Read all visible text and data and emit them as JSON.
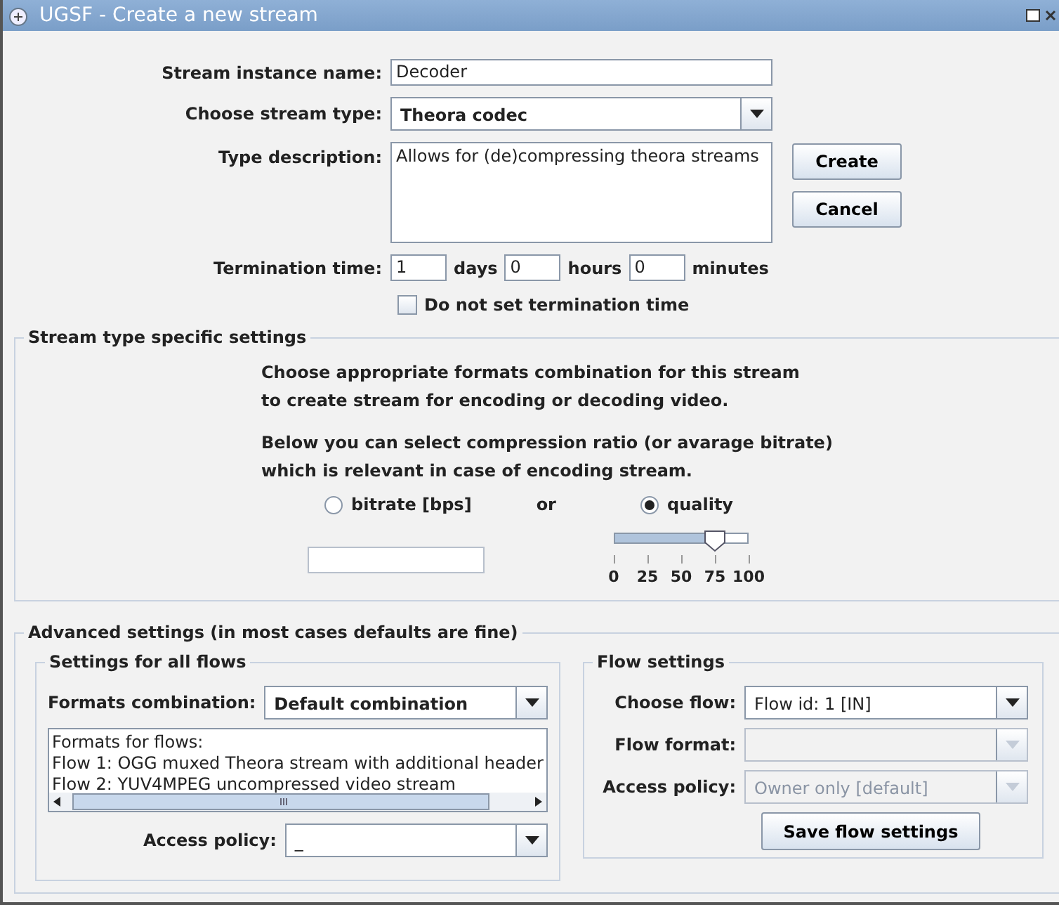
{
  "window": {
    "title": "UGSF - Create a new stream"
  },
  "form": {
    "name": {
      "label": "Stream instance name:",
      "value": "Decoder"
    },
    "type": {
      "label": "Choose stream type:",
      "value": "Theora codec"
    },
    "description": {
      "label": "Type description:",
      "value": "Allows for (de)compressing theora streams"
    },
    "buttons": [
      "Create",
      "Cancel"
    ],
    "termination": {
      "label": "Termination time:",
      "fields": [
        {
          "value": "1",
          "unit": "days"
        },
        {
          "value": "0",
          "unit": "hours"
        },
        {
          "value": "0",
          "unit": "minutes"
        }
      ]
    },
    "no_termination": {
      "label": "Do not set termination time",
      "checked": false
    }
  },
  "stream_settings": {
    "title": "Stream type specific settings",
    "paragraphs": [
      [
        "Choose appropriate formats combination for this stream",
        "to create stream for encoding or decoding video."
      ],
      [
        "Below you can select compression ratio (or avarage bitrate)",
        "which is relevant in case of encoding stream."
      ]
    ],
    "options": [
      {
        "label": "bitrate [bps]",
        "selected": false
      },
      {
        "label": "quality",
        "selected": true
      }
    ],
    "or_label": "or",
    "slider": {
      "level": 0.75,
      "ticks": [
        "0",
        "25",
        "50",
        "75",
        "100"
      ]
    }
  },
  "advanced": {
    "title": "Advanced settings (in most cases defaults are fine)",
    "all_flows": {
      "title": "Settings for all flows",
      "formats_label": "Formats combination:",
      "formats_value": "Default combination",
      "lines": [
        "Formats for flows:",
        "Flow 1: OGG muxed Theora stream with additional header",
        "Flow 2: YUV4MPEG uncompressed video stream"
      ],
      "access_label": "Access policy:",
      "access_value": "_"
    },
    "flow_settings": {
      "title": "Flow settings",
      "rows": [
        {
          "label": "Choose flow:",
          "value": "Flow id: 1 [IN]",
          "disabled": false
        },
        {
          "label": "Flow format:",
          "disabled": true
        },
        {
          "label": "Access policy:",
          "value": "Owner only [default]",
          "disabled": true
        }
      ],
      "save_button": "Save flow settings"
    }
  }
}
